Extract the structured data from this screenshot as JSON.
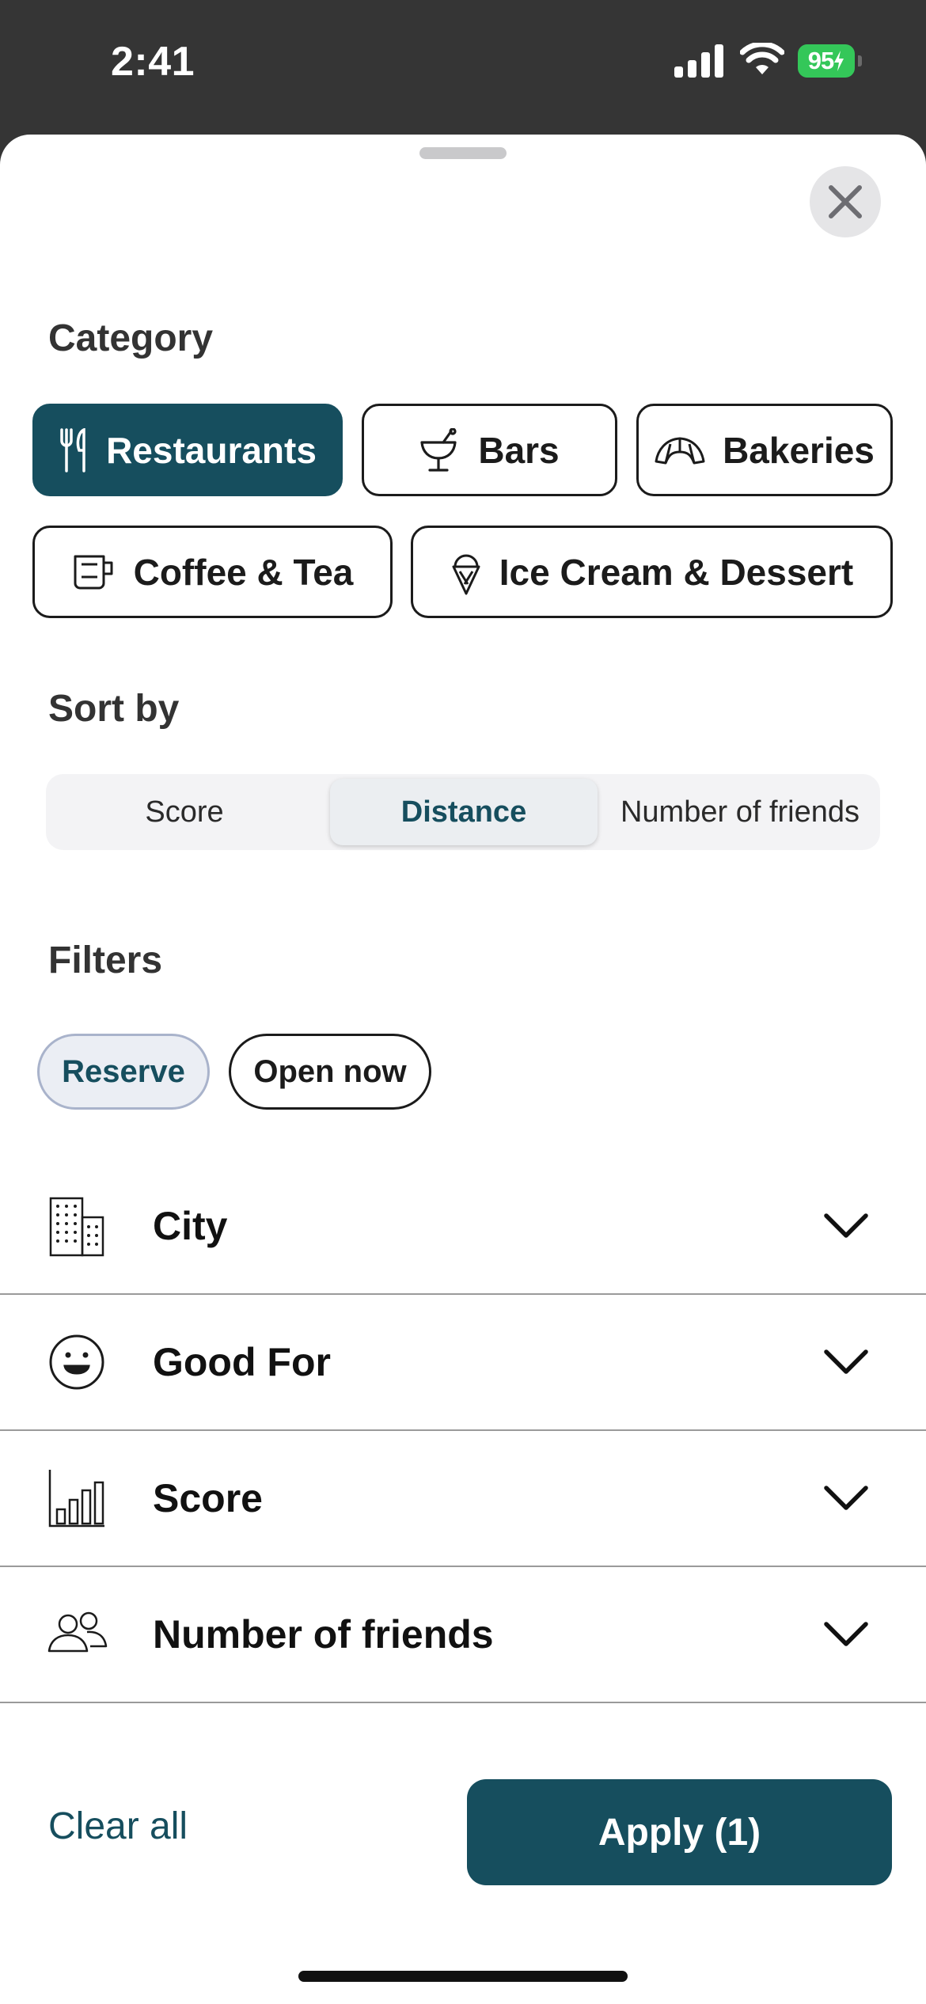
{
  "status_bar": {
    "time": "2:41",
    "battery": "95",
    "icons": [
      "signal-icon",
      "wifi-icon",
      "battery-icon"
    ]
  },
  "sheet": {
    "close_icon": "close-icon"
  },
  "category": {
    "title": "Category",
    "items": [
      {
        "label": "Restaurants",
        "icon": "fork-knife-icon",
        "selected": true
      },
      {
        "label": "Bars",
        "icon": "cocktail-icon",
        "selected": false
      },
      {
        "label": "Bakeries",
        "icon": "croissant-icon",
        "selected": false
      },
      {
        "label": "Coffee & Tea",
        "icon": "coffee-cup-icon",
        "selected": false
      },
      {
        "label": "Ice Cream & Dessert",
        "icon": "ice-cream-icon",
        "selected": false
      }
    ]
  },
  "sort": {
    "title": "Sort by",
    "options": [
      "Score",
      "Distance",
      "Number of friends"
    ],
    "selected": "Distance"
  },
  "filters": {
    "title": "Filters",
    "pills": [
      {
        "label": "Reserve",
        "selected": true
      },
      {
        "label": "Open now",
        "selected": false
      }
    ],
    "rows": [
      {
        "label": "City",
        "icon": "building-icon"
      },
      {
        "label": "Good For",
        "icon": "smiley-icon"
      },
      {
        "label": "Score",
        "icon": "bar-chart-icon"
      },
      {
        "label": "Number of friends",
        "icon": "people-icon"
      }
    ]
  },
  "footer": {
    "clear_label": "Clear all",
    "apply_label": "Apply (1)"
  },
  "colors": {
    "accent": "#164e5e",
    "status_bar_bg": "#353535",
    "battery_green": "#34c759",
    "selected_pill_bg": "#ebeef4"
  }
}
